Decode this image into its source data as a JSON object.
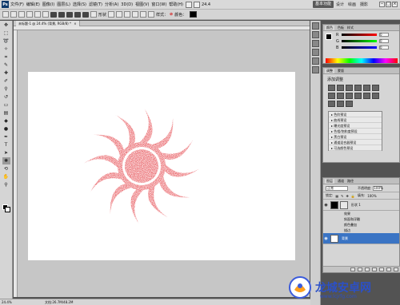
{
  "menubar": {
    "logo": "Ps",
    "items": [
      "文件(F)",
      "编辑(E)",
      "图像(I)",
      "图层(L)",
      "选择(S)",
      "滤镜(T)",
      "分析(A)",
      "3D(D)",
      "视图(V)",
      "窗口(W)",
      "帮助(H)"
    ],
    "zoom": "24.4",
    "workspace_active": "基本功能",
    "workspace_links": [
      "设计",
      "绘画",
      "摄影"
    ],
    "window_controls": [
      "−",
      "□",
      "×"
    ]
  },
  "options": {
    "shape_label": "形状",
    "style_label": "样式：",
    "color_label": "颜色："
  },
  "document": {
    "tab_title": "未标题-1 @ 24.4% (背景, RGB/8) *",
    "close_glyph": "×"
  },
  "status": {
    "zoom": "24.4%",
    "doc_info": "文档:26.7M/48.2M"
  },
  "color_panel": {
    "tabs": [
      "颜色",
      "色板",
      "样式"
    ],
    "sliders": [
      {
        "channel": "R",
        "value": "0",
        "gradient": "linear-gradient(to right,#000,#ff0000)"
      },
      {
        "channel": "G",
        "value": "0",
        "gradient": "linear-gradient(to right,#000,#00ff00)"
      },
      {
        "channel": "B",
        "value": "0",
        "gradient": "linear-gradient(to right,#000,#0000ff)"
      }
    ]
  },
  "adjust_panel": {
    "tabs": [
      "调整",
      "蒙版"
    ],
    "title": "添加调整",
    "presets": [
      "色阶预设",
      "曲线预设",
      "曝光度预设",
      "色相/饱和度预设",
      "黑白预设",
      "通道混合器预设",
      "可选颜色预设"
    ]
  },
  "layers_panel": {
    "tabs": [
      "图层",
      "通道",
      "路径"
    ],
    "blend_mode": "正常",
    "opacity_label": "不透明度:",
    "opacity": "100%",
    "lock_label": "锁定:",
    "fill_label": "填充:",
    "fill": "100%",
    "layers": [
      {
        "name": "形状 1",
        "fx": [
          "效果",
          "斜面和浮雕",
          "颜色叠加",
          "描边"
        ]
      },
      {
        "name": "背景"
      }
    ]
  },
  "colors": {
    "sun_red": "#e0252c",
    "selection": "#3a74c4"
  },
  "watermark": {
    "text": "龙城安卓网",
    "url": "www.lcjrfg.com"
  }
}
